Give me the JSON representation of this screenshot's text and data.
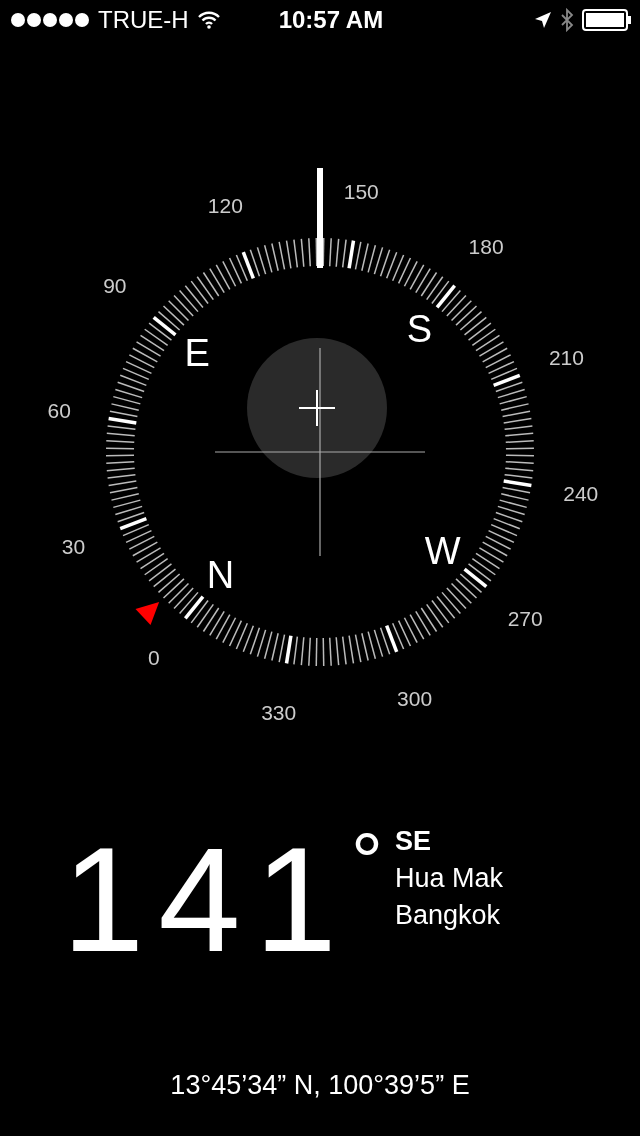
{
  "status_bar": {
    "carrier": "TRUE-H",
    "time": "10:57 AM"
  },
  "compass": {
    "dial_labels": [
      "0",
      "30",
      "60",
      "90",
      "120",
      "150",
      "180",
      "210",
      "240",
      "270",
      "300",
      "330"
    ],
    "cardinals": [
      "N",
      "E",
      "S",
      "W"
    ]
  },
  "reading": {
    "heading": "141",
    "degree_sign": "°",
    "direction": "SE",
    "place_lines": [
      "Hua Mak",
      "Bangkok"
    ]
  },
  "coordinates": "13°45’34” N, 100°39’5” E"
}
